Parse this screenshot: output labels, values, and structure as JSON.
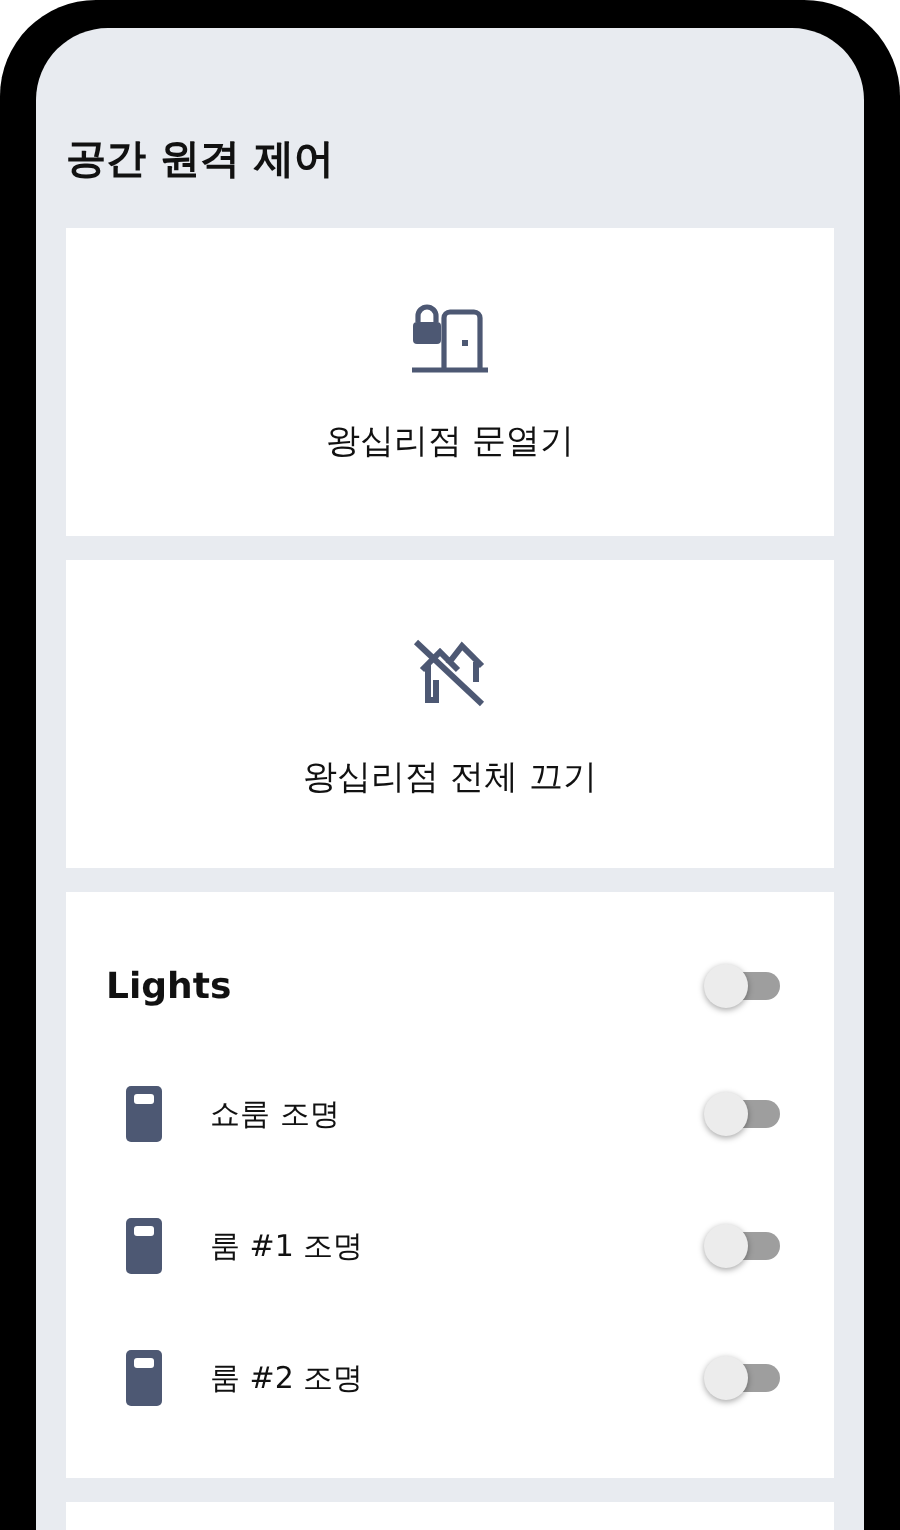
{
  "title": "공간 원격 제어",
  "actions": [
    {
      "label": "왕십리점 문열기"
    },
    {
      "label": "왕십리점 전체 끄기"
    }
  ],
  "lights": {
    "title": "Lights",
    "on": false,
    "items": [
      {
        "label": "쇼룸 조명",
        "on": false
      },
      {
        "label": "룸 #1 조명",
        "on": false
      },
      {
        "label": "룸 #2 조명",
        "on": false
      }
    ]
  }
}
